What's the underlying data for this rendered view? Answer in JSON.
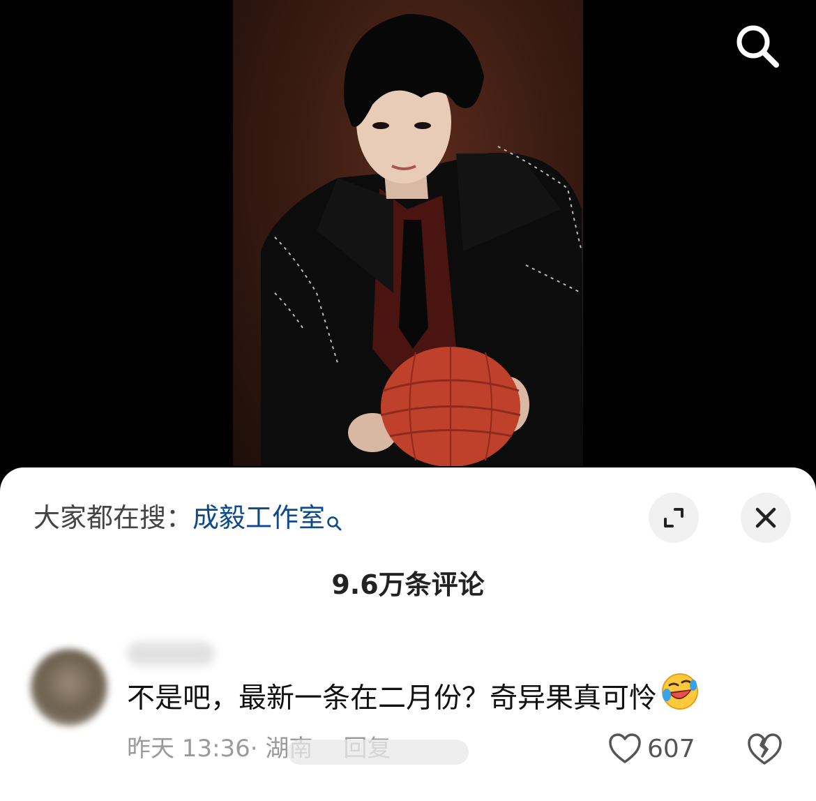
{
  "header": {
    "search_icon": "search-icon"
  },
  "sheet": {
    "hot_search_prefix": "大家都在搜：",
    "hot_search_term": "成毅工作室",
    "hot_search_icon": "search-icon",
    "expand_icon": "expand-icon",
    "close_icon": "close-icon",
    "comment_count": "9.6万条评论"
  },
  "comment": {
    "text": "不是吧，最新一条在二月份？奇异果真可怜",
    "emoji": "rolling-on-floor-laughing-icon",
    "time": "昨天 13:36",
    "location": "· 湖南",
    "reply_label": "回复",
    "like_count": "607",
    "like_icon": "heart-icon",
    "dislike_icon": "broken-heart-icon"
  },
  "colors": {
    "hot_term": "#0c4a8a",
    "text": "#111111",
    "meta": "#9a9a9a"
  }
}
